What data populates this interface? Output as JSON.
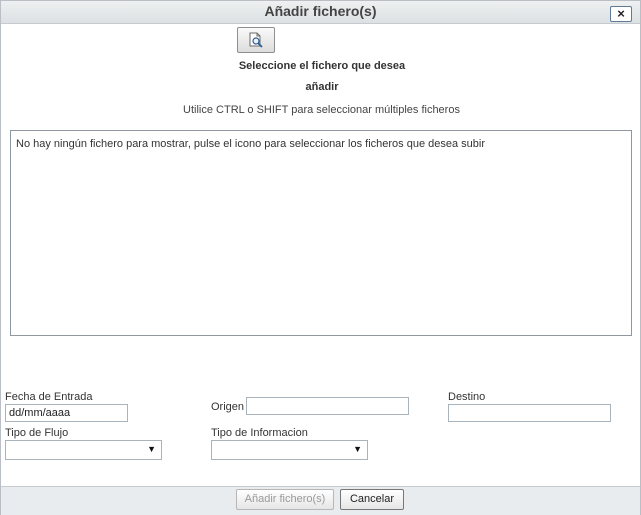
{
  "dialog": {
    "title": "Añadir fichero(s)",
    "close_label": "×"
  },
  "upload": {
    "browse_icon": "magnifier-file-icon",
    "select_label": "Seleccione el fichero que desea añadir",
    "hint": "Utilice CTRL o SHIFT para seleccionar múltiples ficheros",
    "empty_message": "No hay ningún fichero para mostrar, pulse el icono para seleccionar los ficheros que desea subir"
  },
  "form": {
    "fecha_label": "Fecha de Entrada",
    "fecha_value": "dd/mm/aaaa",
    "origen_label": "Origen",
    "origen_value": "",
    "destino_label": "Destino",
    "destino_value": "",
    "tipo_flujo_label": "Tipo de Flujo",
    "tipo_flujo_value": "",
    "tipo_info_label": "Tipo de Informacion",
    "tipo_info_value": ""
  },
  "footer": {
    "add_label": "Añadir fichero(s)",
    "cancel_label": "Cancelar"
  }
}
